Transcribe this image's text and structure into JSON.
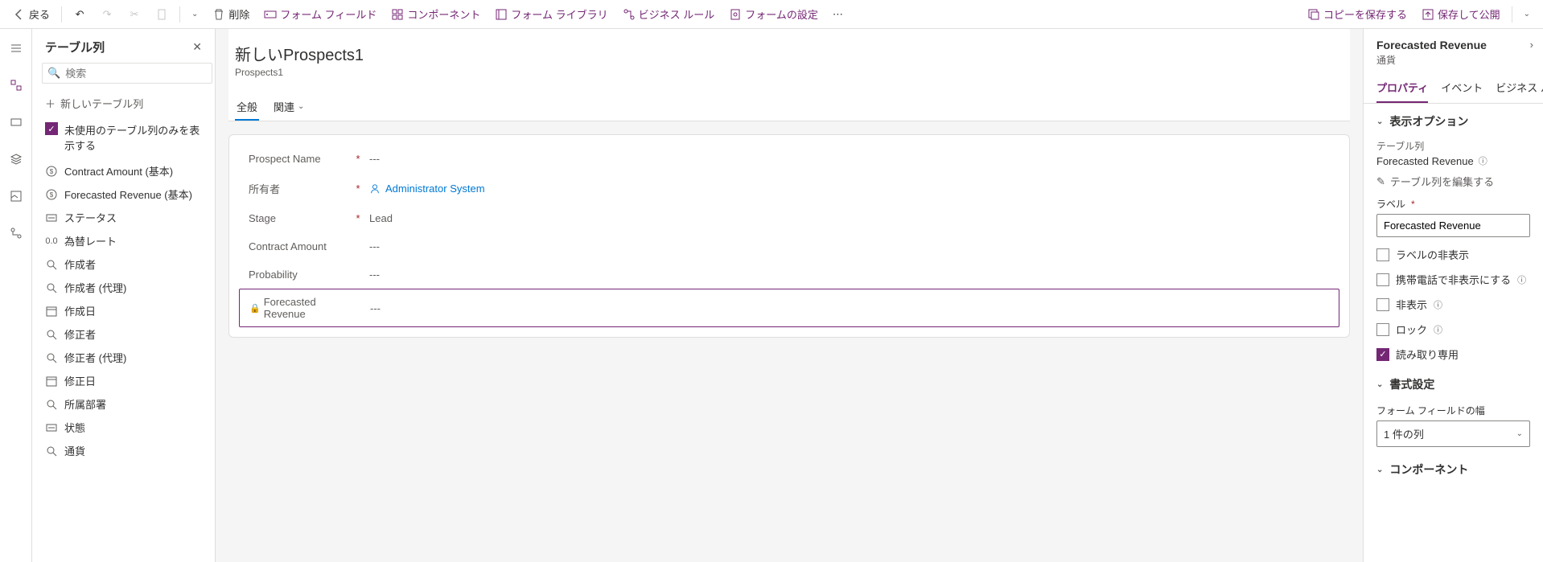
{
  "toolbar": {
    "back": "戻る",
    "delete": "削除",
    "form_field": "フォーム フィールド",
    "component": "コンポーネント",
    "form_library": "フォーム ライブラリ",
    "business_rule": "ビジネス ルール",
    "form_settings": "フォームの設定",
    "save_copy": "コピーを保存する",
    "save_publish": "保存して公開"
  },
  "left": {
    "title": "テーブル列",
    "search_ph": "検索",
    "new_col": "新しいテーブル列",
    "unused_only": "未使用のテーブル列のみを表示する",
    "items": [
      {
        "icon": "currency",
        "label": "Contract Amount (基本)"
      },
      {
        "icon": "currency",
        "label": "Forecasted Revenue (基本)"
      },
      {
        "icon": "enum",
        "label": "ステータス"
      },
      {
        "icon": "decimal",
        "label": "為替レート"
      },
      {
        "icon": "lookup",
        "label": "作成者"
      },
      {
        "icon": "lookup",
        "label": "作成者 (代理)"
      },
      {
        "icon": "date",
        "label": "作成日"
      },
      {
        "icon": "lookup",
        "label": "修正者"
      },
      {
        "icon": "lookup",
        "label": "修正者 (代理)"
      },
      {
        "icon": "date",
        "label": "修正日"
      },
      {
        "icon": "lookup",
        "label": "所属部署"
      },
      {
        "icon": "enum",
        "label": "状態"
      },
      {
        "icon": "lookup",
        "label": "通貨"
      }
    ]
  },
  "canvas": {
    "title": "新しいProspects1",
    "sub": "Prospects1",
    "tab_general": "全般",
    "tab_related": "関連",
    "rows": [
      {
        "label": "Prospect Name",
        "req": true,
        "val": "---"
      },
      {
        "label": "所有者",
        "req": true,
        "val": "Administrator System",
        "link": true
      },
      {
        "label": "Stage",
        "req": true,
        "val": "Lead"
      },
      {
        "label": "Contract Amount",
        "req": false,
        "val": "---"
      },
      {
        "label": "Probability",
        "req": false,
        "val": "---"
      },
      {
        "label": "Forecasted Revenue",
        "req": false,
        "val": "---",
        "locked": true,
        "selected": true
      }
    ]
  },
  "right": {
    "title": "Forecasted Revenue",
    "sub": "通貨",
    "tab_props": "プロパティ",
    "tab_events": "イベント",
    "tab_biz": "ビジネス ル...",
    "section_display": "表示オプション",
    "table_col": "テーブル列",
    "field_name": "Forecasted Revenue",
    "edit_col": "テーブル列を編集する",
    "label_lbl": "ラベル",
    "label_val": "Forecasted Revenue",
    "hide_label": "ラベルの非表示",
    "hide_phone": "携帯電話で非表示にする",
    "hide": "非表示",
    "lock": "ロック",
    "readonly": "読み取り専用",
    "section_format": "書式設定",
    "field_width_lbl": "フォーム フィールドの幅",
    "field_width_val": "1 件の列",
    "section_component": "コンポーネント"
  }
}
